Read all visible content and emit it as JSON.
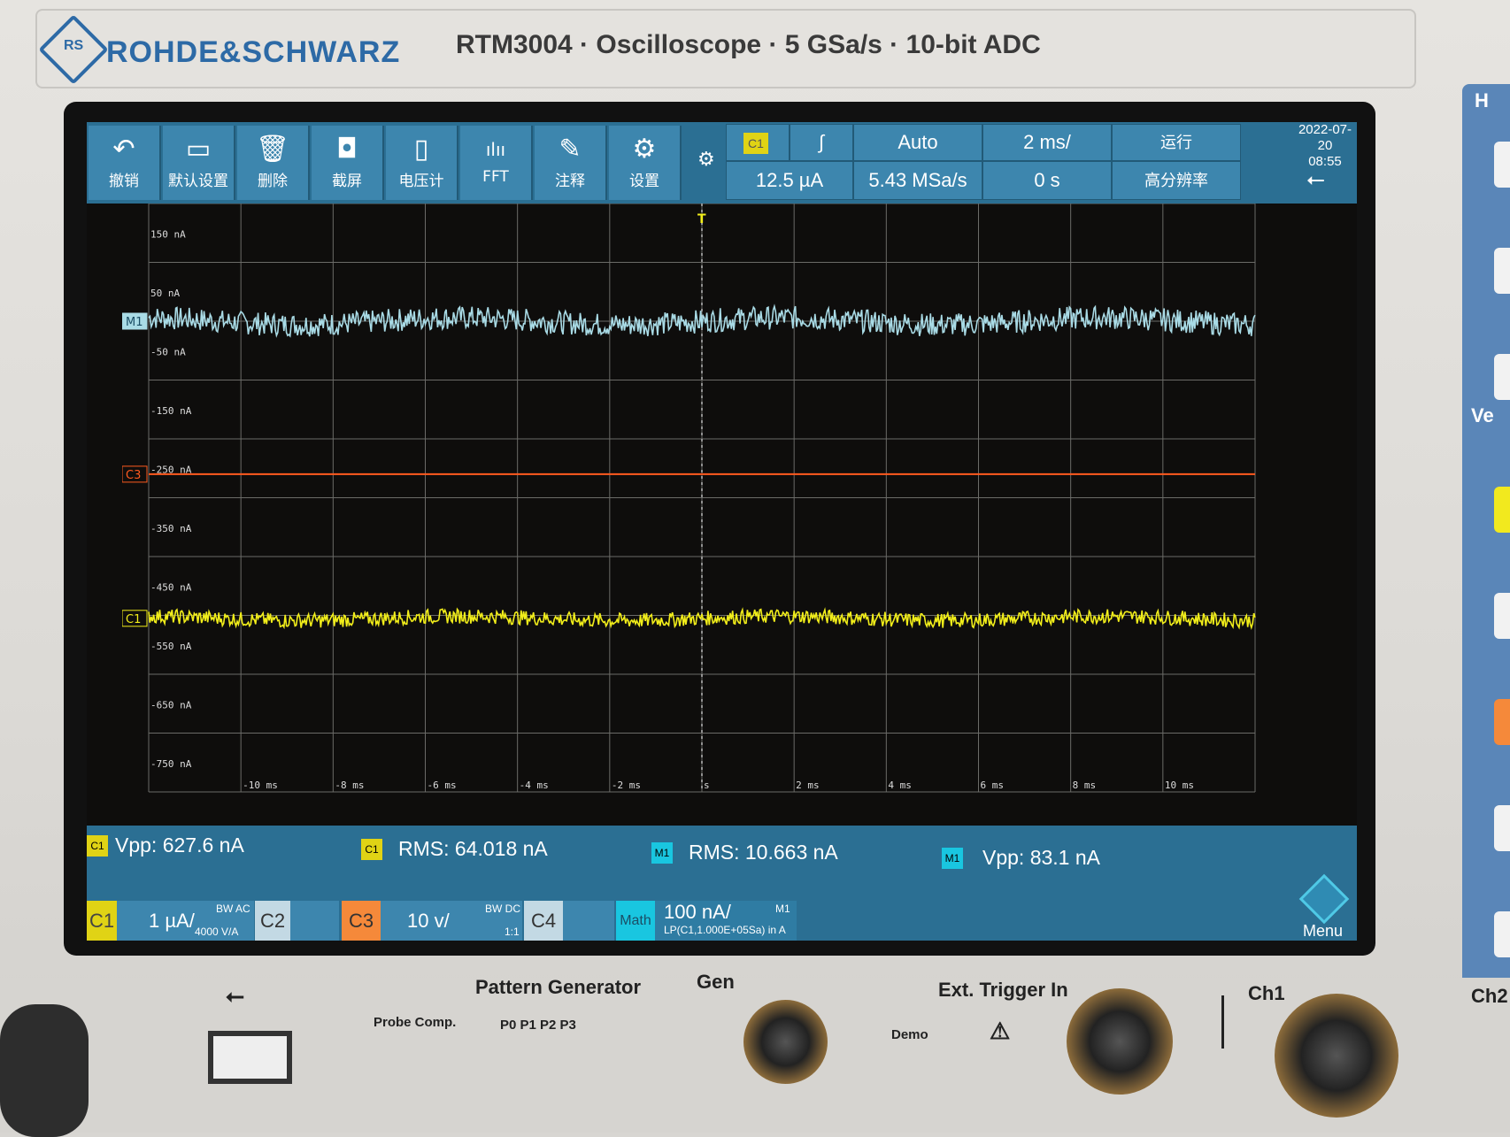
{
  "header": {
    "brand": "ROHDE&SCHWARZ",
    "logo_text": "RS",
    "model_line": "RTM3004 · Oscilloscope · 5 GSa/s · 10-bit ADC"
  },
  "toolbar": {
    "tools": [
      {
        "icon": "↶",
        "label": "撤销"
      },
      {
        "icon": "▭",
        "label": "默认设置"
      },
      {
        "icon": "🗑",
        "label": "删除"
      },
      {
        "icon": "◘",
        "label": "截屏"
      },
      {
        "icon": "▯",
        "label": "电压计"
      },
      {
        "icon": "ılıı",
        "label": "FFT"
      },
      {
        "icon": "✎",
        "label": "注释"
      },
      {
        "icon": "⚙",
        "label": "设置"
      }
    ],
    "small_gear": "⚙",
    "trigger_channel": "C1",
    "trigger_slope": "∫",
    "trigger_level": "12.5 µA",
    "trigger_mode": "Auto",
    "sample_rate": "5.43 MSa/s",
    "time_base": "2 ms/",
    "time_offset": "0 s",
    "run_state": "运行",
    "acq_mode": "高分辨率",
    "date": "2022-07-20",
    "time": "08:55",
    "usb_icon": "⭠"
  },
  "chart_data": {
    "type": "line",
    "grid": true,
    "y_tick_labels": [
      "150 nA",
      "50 nA",
      "-50 nA",
      "-150 nA",
      "-250 nA",
      "-350 nA",
      "-450 nA",
      "-550 nA",
      "-650 nA",
      "-750 nA"
    ],
    "x_tick_labels": [
      "-10 ms",
      "-8 ms",
      "-6 ms",
      "-4 ms",
      "-2 ms",
      "s",
      "2 ms",
      "4 ms",
      "6 ms",
      "8 ms",
      "10 ms"
    ],
    "xlim": [
      -12,
      12
    ],
    "ylim": [
      -800,
      200
    ],
    "trigger_marker": "T",
    "series": [
      {
        "name": "M1",
        "color": "#a9dbe6",
        "level_nA": 0,
        "noise_nA": 40
      },
      {
        "name": "C3",
        "color": "#ff5a1f",
        "level_nA": -260,
        "noise_nA": 0
      },
      {
        "name": "C1",
        "color": "#f2ee1a",
        "level_nA": -505,
        "noise_nA": 25
      }
    ]
  },
  "measurements": [
    {
      "badge": "C1",
      "badge_color": "#e0d315",
      "text": "Vpp: 627.6 nA"
    },
    {
      "badge": "C1",
      "badge_color": "#e0d315",
      "text": "RMS: 64.018 nA"
    },
    {
      "badge": "M1",
      "badge_color": "#19c6e0",
      "text": "RMS: 10.663 nA"
    },
    {
      "badge": "M1",
      "badge_color": "#19c6e0",
      "text": "Vpp: 83.1 nA"
    }
  ],
  "channels": {
    "c1_label": "C1",
    "c1_scale": "1 µA/",
    "c1_bw": "BW AC",
    "c1_factor": "4000 V/A",
    "c2_label": "C2",
    "c3_label": "C3",
    "c3_scale": "10 v/",
    "c3_bw": "BW DC",
    "c3_factor": "1:1",
    "c4_label": "C4",
    "math_label": "Math",
    "math_scale": "100 nA/",
    "math_ref": "M1",
    "math_expr": "LP(C1,1.000E+05Sa) in A",
    "menu": "Menu"
  },
  "front_panel": {
    "pattern_gen": "Pattern Generator",
    "probe_comp": "Probe Comp.",
    "pins": "P0  P1  P2  P3",
    "gen": "Gen",
    "ext_trigger": "Ext. Trigger In",
    "demo": "Demo",
    "ch1": "Ch1",
    "ch2": "Ch2"
  },
  "side_labels": {
    "top": "H",
    "mid": "Ve"
  }
}
